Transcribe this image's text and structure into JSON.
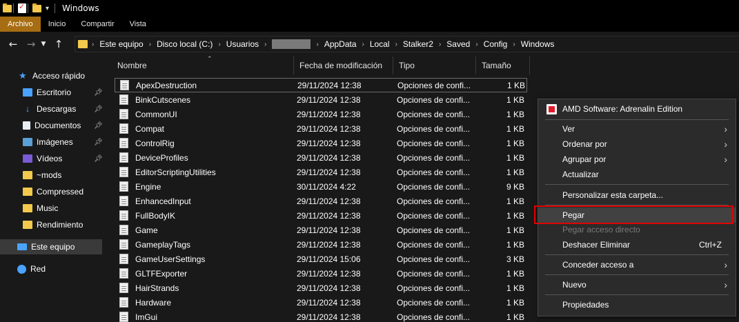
{
  "window": {
    "title": "Windows"
  },
  "ribbon": {
    "tabs": [
      "Archivo",
      "Inicio",
      "Compartir",
      "Vista"
    ],
    "active_tab": "Archivo",
    "active_color": "#a66d12"
  },
  "address": {
    "crumbs": [
      "Este equipo",
      "Disco local (C:)",
      "Usuarios",
      "AppData",
      "Local",
      "Stalker2",
      "Saved",
      "Config",
      "Windows"
    ],
    "redacted_after": "Usuarios"
  },
  "sidebar": {
    "items": [
      {
        "label": "Acceso rápido",
        "icon": "star-icon",
        "pinned": false
      },
      {
        "label": "Escritorio",
        "icon": "desktop-icon",
        "pinned": true
      },
      {
        "label": "Descargas",
        "icon": "download-icon",
        "pinned": true
      },
      {
        "label": "Documentos",
        "icon": "documents-icon",
        "pinned": true
      },
      {
        "label": "Imágenes",
        "icon": "pictures-icon",
        "pinned": true
      },
      {
        "label": "Vídeos",
        "icon": "videos-icon",
        "pinned": true
      },
      {
        "label": "~mods",
        "icon": "folder-icon",
        "pinned": false
      },
      {
        "label": "Compressed",
        "icon": "folder-icon",
        "pinned": false
      },
      {
        "label": "Music",
        "icon": "folder-icon",
        "pinned": false
      },
      {
        "label": "Rendimiento",
        "icon": "folder-icon",
        "pinned": false
      },
      {
        "label": "Este equipo",
        "icon": "computer-icon",
        "pinned": false,
        "selected": true
      },
      {
        "label": "Red",
        "icon": "network-icon",
        "pinned": false
      }
    ]
  },
  "file_list": {
    "columns": [
      "Nombre",
      "Fecha de modificación",
      "Tipo",
      "Tamaño"
    ],
    "rows": [
      {
        "name": "ApexDestruction",
        "date": "29/11/2024 12:38",
        "type": "Opciones de confi...",
        "size": "1 KB"
      },
      {
        "name": "BinkCutscenes",
        "date": "29/11/2024 12:38",
        "type": "Opciones de confi...",
        "size": "1 KB"
      },
      {
        "name": "CommonUI",
        "date": "29/11/2024 12:38",
        "type": "Opciones de confi...",
        "size": "1 KB"
      },
      {
        "name": "Compat",
        "date": "29/11/2024 12:38",
        "type": "Opciones de confi...",
        "size": "1 KB"
      },
      {
        "name": "ControlRig",
        "date": "29/11/2024 12:38",
        "type": "Opciones de confi...",
        "size": "1 KB"
      },
      {
        "name": "DeviceProfiles",
        "date": "29/11/2024 12:38",
        "type": "Opciones de confi...",
        "size": "1 KB"
      },
      {
        "name": "EditorScriptingUtilities",
        "date": "29/11/2024 12:38",
        "type": "Opciones de confi...",
        "size": "1 KB"
      },
      {
        "name": "Engine",
        "date": "30/11/2024 4:22",
        "type": "Opciones de confi...",
        "size": "9 KB"
      },
      {
        "name": "EnhancedInput",
        "date": "29/11/2024 12:38",
        "type": "Opciones de confi...",
        "size": "1 KB"
      },
      {
        "name": "FullBodyIK",
        "date": "29/11/2024 12:38",
        "type": "Opciones de confi...",
        "size": "1 KB"
      },
      {
        "name": "Game",
        "date": "29/11/2024 12:38",
        "type": "Opciones de confi...",
        "size": "1 KB"
      },
      {
        "name": "GameplayTags",
        "date": "29/11/2024 12:38",
        "type": "Opciones de confi...",
        "size": "1 KB"
      },
      {
        "name": "GameUserSettings",
        "date": "29/11/2024 15:06",
        "type": "Opciones de confi...",
        "size": "3 KB"
      },
      {
        "name": "GLTFExporter",
        "date": "29/11/2024 12:38",
        "type": "Opciones de confi...",
        "size": "1 KB"
      },
      {
        "name": "HairStrands",
        "date": "29/11/2024 12:38",
        "type": "Opciones de confi...",
        "size": "1 KB"
      },
      {
        "name": "Hardware",
        "date": "29/11/2024 12:38",
        "type": "Opciones de confi...",
        "size": "1 KB"
      },
      {
        "name": "ImGui",
        "date": "29/11/2024 12:38",
        "type": "Opciones de confi...",
        "size": "1 KB"
      }
    ]
  },
  "context_menu": {
    "header": "AMD Software: Adrenalin Edition",
    "items": [
      {
        "label": "Ver",
        "submenu": true
      },
      {
        "label": "Ordenar por",
        "submenu": true
      },
      {
        "label": "Agrupar por",
        "submenu": true
      },
      {
        "label": "Actualizar"
      },
      {
        "label": "Personalizar esta carpeta..."
      },
      {
        "label": "Pegar",
        "highlighted": true
      },
      {
        "label": "Pegar acceso directo",
        "disabled": true
      },
      {
        "label": "Deshacer Eliminar",
        "shortcut": "Ctrl+Z"
      },
      {
        "label": "Conceder acceso a",
        "submenu": true
      },
      {
        "label": "Nuevo",
        "submenu": true
      },
      {
        "label": "Propiedades"
      }
    ],
    "highlight_color": "#e00000"
  }
}
